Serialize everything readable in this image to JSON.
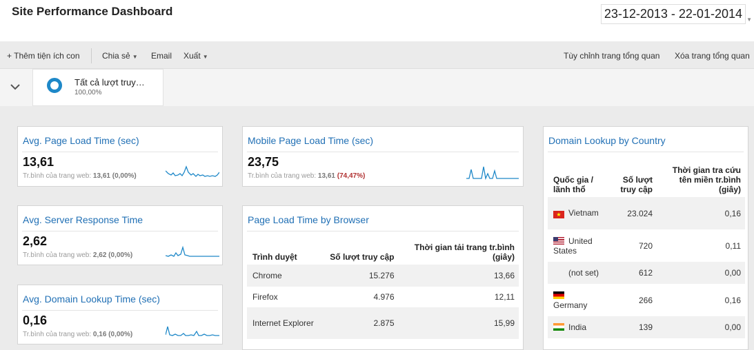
{
  "header": {
    "title": "Site Performance Dashboard",
    "date_range": "23-12-2013 - 22-01-2014"
  },
  "toolbar": {
    "add_widget": "+ Thêm tiện ích con",
    "share": "Chia sẻ",
    "email": "Email",
    "export": "Xuất",
    "customize": "Tùy chỉnh trang tổng quan",
    "delete": "Xóa trang tổng quan"
  },
  "segment": {
    "name": "Tất cả lượt truy…",
    "percent": "100,00%"
  },
  "widgets": {
    "avg_page_load": {
      "title": "Avg. Page Load Time (sec)",
      "value": "13,61",
      "sub_label": "Tr.bình của trang web:",
      "sub_value": "13,61",
      "sub_change": "(0,00%)"
    },
    "avg_server_response": {
      "title": "Avg. Server Response Time",
      "value": "2,62",
      "sub_label": "Tr.bình của trang web:",
      "sub_value": "2,62",
      "sub_change": "(0,00%)"
    },
    "avg_domain_lookup": {
      "title": "Avg. Domain Lookup Time (sec)",
      "value": "0,16",
      "sub_label": "Tr.bình của trang web:",
      "sub_value": "0,16",
      "sub_change": "(0,00%)"
    },
    "mobile_page_load": {
      "title": "Mobile Page Load Time (sec)",
      "value": "23,75",
      "sub_label": "Tr.bình của trang web:",
      "sub_value": "13,61",
      "sub_change": "(74,47%)"
    },
    "by_browser": {
      "title": "Page Load Time by Browser",
      "headers": [
        "Trình duyệt",
        "Số lượt truy cập",
        "Thời gian tải trang tr.bình (giây)"
      ],
      "rows": [
        {
          "browser": "Chrome",
          "visits": "15.276",
          "time": "13,66"
        },
        {
          "browser": "Firefox",
          "visits": "4.976",
          "time": "12,11"
        },
        {
          "browser": "Internet Explorer",
          "visits": "2.875",
          "time": "15,99"
        }
      ]
    },
    "by_country": {
      "title": "Domain Lookup by Country",
      "headers": [
        "Quốc gia / lãnh thổ",
        "Số lượt truy cập",
        "Thời gian tra cứu tên miền tr.bình (giây)"
      ],
      "rows": [
        {
          "country": "Vietnam",
          "flag": "vn-flag-icon",
          "visits": "23.024",
          "time": "0,16"
        },
        {
          "country": "United States",
          "flag": "us-flag-icon",
          "visits": "720",
          "time": "0,11"
        },
        {
          "country": "(not set)",
          "flag": "",
          "visits": "612",
          "time": "0,00"
        },
        {
          "country": "Germany",
          "flag": "de-flag-icon",
          "visits": "266",
          "time": "0,16"
        },
        {
          "country": "India",
          "flag": "in-flag-icon",
          "visits": "139",
          "time": "0,00"
        }
      ]
    }
  },
  "colors": {
    "accent": "#2170b5",
    "sparkline": "#1e88c8",
    "negative": "#b03030"
  }
}
